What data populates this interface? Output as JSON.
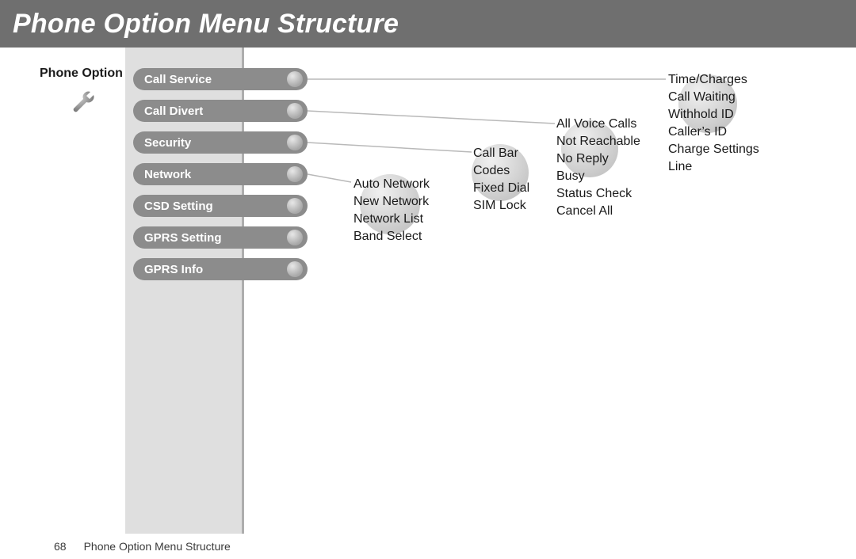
{
  "header": {
    "title": "Phone Option Menu Structure"
  },
  "sidebar": {
    "label": "Phone Option",
    "icon": "wrench-icon"
  },
  "pills": [
    "Call Service",
    "Call Divert",
    "Security",
    "Network",
    "CSD Setting",
    "GPRS Setting",
    "GPRS Info"
  ],
  "columns": {
    "call_service": [
      "Time/Charges",
      "Call Waiting",
      "Withhold ID",
      "Caller’s ID",
      "Charge Settings",
      "Line"
    ],
    "call_divert": [
      "All Voice Calls",
      "Not Reachable",
      "No Reply",
      "Busy",
      "Status Check",
      "Cancel All"
    ],
    "security": [
      "Call Bar",
      "Codes",
      "Fixed Dial",
      "SIM Lock"
    ],
    "network": [
      "Auto Network",
      "New Network",
      "Network List",
      "Band Select"
    ]
  },
  "footer": {
    "page_number": "68",
    "caption": "Phone Option Menu Structure"
  }
}
